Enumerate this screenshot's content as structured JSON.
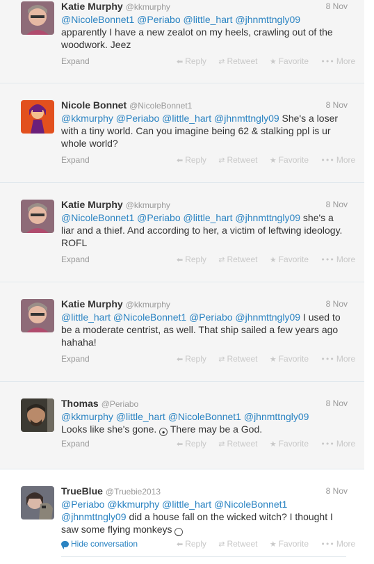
{
  "tweets": [
    {
      "fullname": "Katie Murphy",
      "username": "@kkmurphy",
      "time": "8 Nov",
      "mentions": "@NicoleBonnet1 @Periabo @little_hart @jhnmttngly09",
      "text": "apparently I have a new zealot on my heels, crawling out of the woodwork. Jeez",
      "expand": "Expand"
    },
    {
      "fullname": "Nicole Bonnet",
      "username": "@NicoleBonnet1",
      "time": "8 Nov",
      "mentions": "@kkmurphy @Periabo @little_hart @jhnmttngly09",
      "text": "She's a loser with a tiny world. Can you imagine being 62 & stalking ppl is ur whole world?",
      "expand": "Expand"
    },
    {
      "fullname": "Katie Murphy",
      "username": "@kkmurphy",
      "time": "8 Nov",
      "mentions": "@NicoleBonnet1 @Periabo @little_hart @jhnmttngly09",
      "text": "she's a liar and a thief. And according to her, a victim of leftwing ideology. ROFL",
      "expand": "Expand"
    },
    {
      "fullname": "Katie Murphy",
      "username": "@kkmurphy",
      "time": "8 Nov",
      "mentions": "@little_hart @NicoleBonnet1 @Periabo @jhnmttngly09",
      "text": "I used to be a moderate centrist, as well. That ship sailed a few years ago hahaha!",
      "expand": "Expand"
    },
    {
      "fullname": "Thomas",
      "username": "@Periabo",
      "time": "8 Nov",
      "mentions": "@kkmurphy @little_hart @NicoleBonnet1 @jhnmttngly09",
      "text_before": "Looks like she's gone.",
      "text_after": "There may be a God.",
      "expand": "Expand"
    },
    {
      "fullname": "TrueBlue",
      "username": "@Truebie2013",
      "time": "8 Nov",
      "mentions": "@Periabo @kkmurphy @little_hart @NicoleBonnet1 @jhnmttngly09",
      "text": "did a house fall on the wicked witch? I thought I saw some flying monkeys",
      "expand": "Hide conversation"
    }
  ],
  "actions": {
    "reply": "Reply",
    "retweet": "Retweet",
    "favorite": "Favorite",
    "more": "More"
  },
  "colors": {
    "link": "#2a83c2",
    "muted": "#999999",
    "background": "#f5f5f5"
  }
}
